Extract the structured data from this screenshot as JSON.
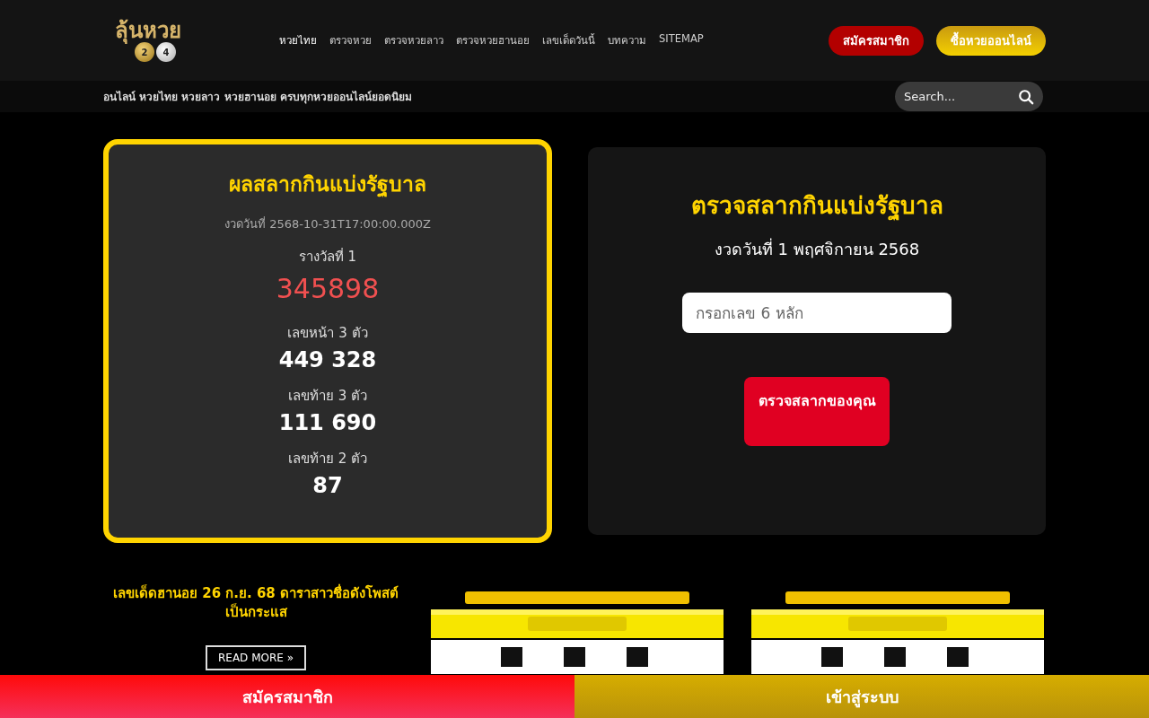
{
  "logo": {
    "text": "ลุ้นหวย",
    "balls": [
      "2",
      "4"
    ]
  },
  "nav": [
    {
      "label": "หวยไทย",
      "selected": true
    },
    {
      "label": "ตรวจหวย",
      "selected": false
    },
    {
      "label": "ตรวจหวยลาว",
      "selected": false
    },
    {
      "label": "ตรวจหวยฮานอย",
      "selected": false
    },
    {
      "label": "เลขเด็ดวันนี้",
      "selected": false
    },
    {
      "label": "บทความ",
      "selected": false
    },
    {
      "label": "SITEMAP",
      "selected": false
    }
  ],
  "header_buttons": [
    {
      "label": "สมัครสมาชิก",
      "kind": "red"
    },
    {
      "label": "ซื้อหวยออนไลน์",
      "kind": "gold"
    }
  ],
  "tagline": "อนไลน์ หวยไทย หวยลาว หวยฮานอย ครบทุกหวยออนไลน์ยอดนิยม",
  "search": {
    "placeholder": "Search..."
  },
  "result_card": {
    "title": "ผลสลากกินแบ่งรัฐบาล",
    "date": "งวดวันที่ 2568-10-31T17:00:00.000Z",
    "prizes": [
      {
        "label": "รางวัลที่ 1",
        "value": "345898",
        "kind": "main"
      },
      {
        "label": "เลขหน้า 3 ตัว",
        "value": "449 328",
        "kind": "normal"
      },
      {
        "label": "เลขท้าย 3 ตัว",
        "value": "111 690",
        "kind": "normal"
      },
      {
        "label": "เลขท้าย 2 ตัว",
        "value": "87",
        "kind": "normal"
      }
    ]
  },
  "check_card": {
    "title": "ตรวจสลากกินแบ่งรัฐบาล",
    "date": "งวดวันที่ 1 พฤศจิกายน 2568",
    "input": {
      "placeholder": "กรอกเลข 6 หลัก"
    },
    "button": "ตรวจสลากของคุณ"
  },
  "articles": [
    {
      "kind": "text",
      "title": "เลขเด็ดฮานอย 26 ก.ย. 68 ดาราสาวชื่อดังโพสต์เป็นกระแส",
      "button": "READ MORE »"
    },
    {
      "kind": "picture"
    },
    {
      "kind": "picture"
    }
  ],
  "bottom_bar": [
    {
      "label": "สมัครสมาชิก",
      "kind": "red"
    },
    {
      "label": "เข้าสู่ระบบ",
      "kind": "gold"
    }
  ]
}
